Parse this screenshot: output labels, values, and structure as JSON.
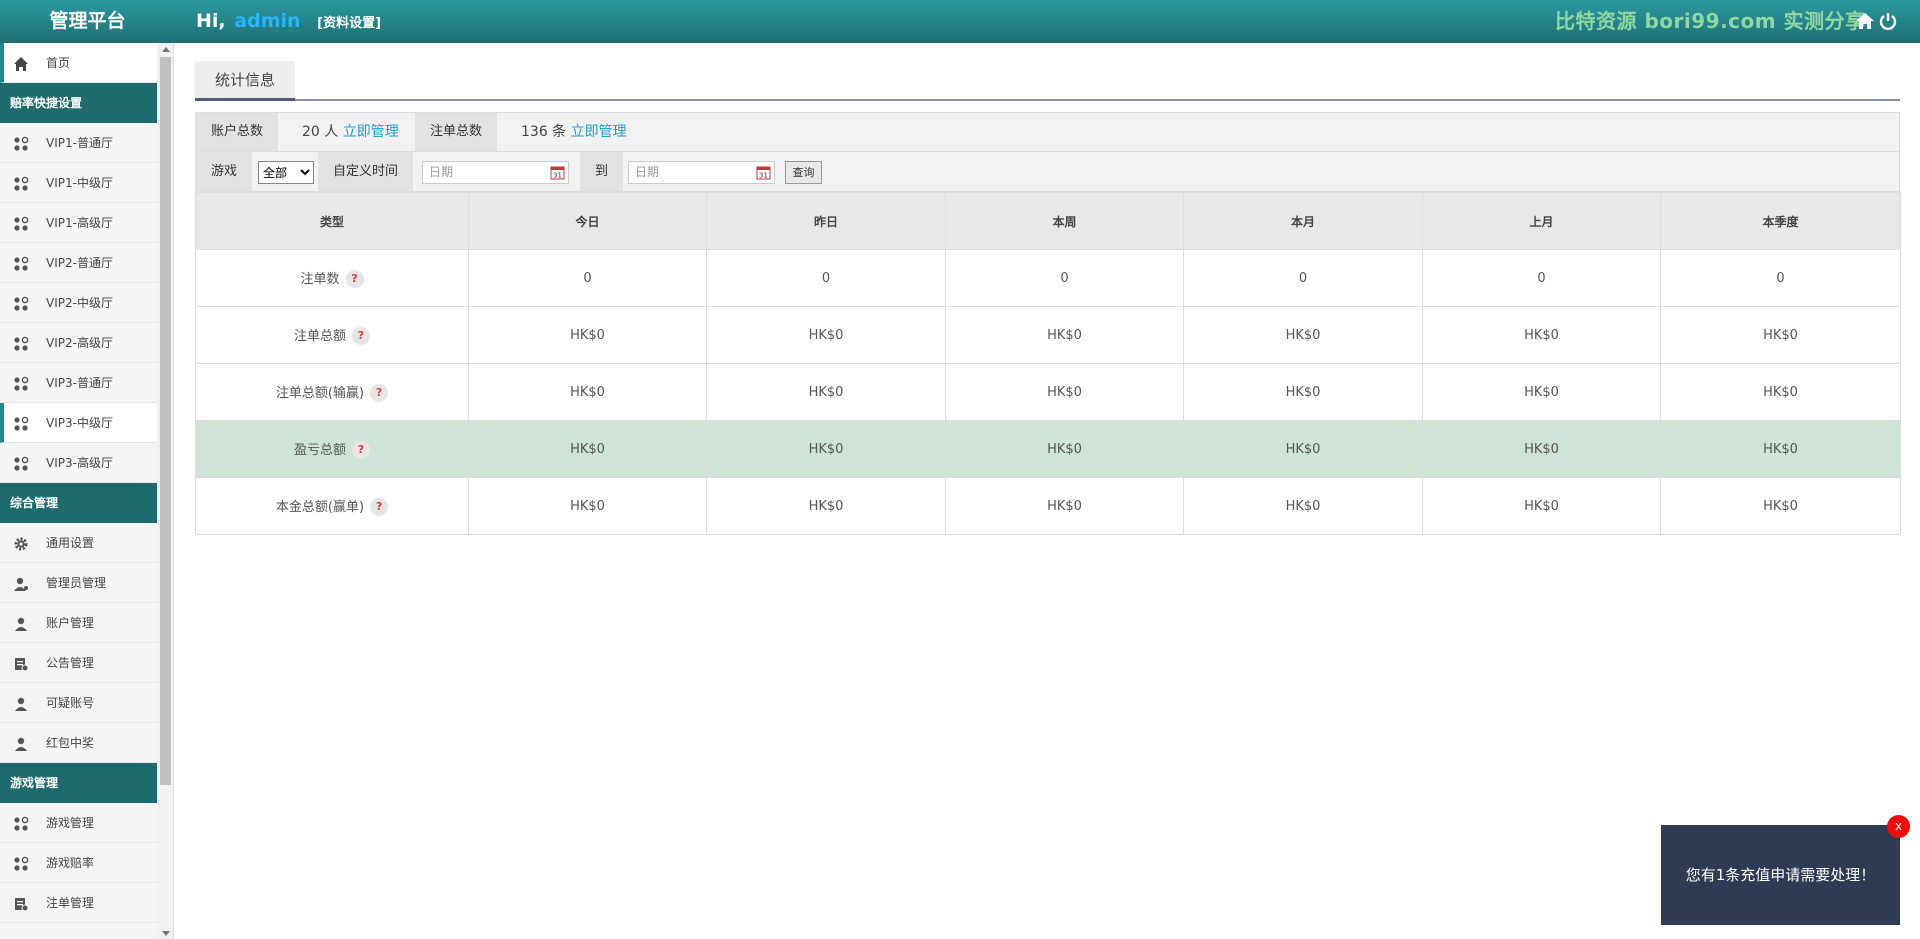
{
  "header": {
    "brand": "管理平台",
    "greeting": "Hi,",
    "username": "admin",
    "profile_link": "[资料设置]",
    "watermark": "比特资源 bori99.com 实测分享"
  },
  "sidebar": {
    "home": "首页",
    "groups": [
      {
        "title": "赔率快捷设置",
        "items": [
          "VIP1-普通厅",
          "VIP1-中级厅",
          "VIP1-高级厅",
          "VIP2-普通厅",
          "VIP2-中级厅",
          "VIP2-高级厅",
          "VIP3-普通厅",
          "VIP3-中级厅",
          "VIP3-高级厅"
        ]
      },
      {
        "title": "综合管理",
        "items": [
          "通用设置",
          "管理员管理",
          "账户管理",
          "公告管理",
          "可疑账号",
          "红包中奖"
        ]
      },
      {
        "title": "游戏管理",
        "items": [
          "游戏管理",
          "游戏赔率",
          "注单管理"
        ]
      }
    ],
    "active_item": "VIP3-中级厅"
  },
  "main": {
    "tab": "统计信息",
    "summary": {
      "accounts_label": "账户总数",
      "accounts_value": "20 人",
      "accounts_link": "立即管理",
      "orders_label": "注单总数",
      "orders_value": "136 条",
      "orders_link": "立即管理"
    },
    "filter": {
      "game_label": "游戏",
      "game_selected": "全部",
      "custom_time_label": "自定义时间",
      "date_placeholder": "日期",
      "to_label": "到",
      "query_button": "查询"
    },
    "table": {
      "headers": [
        "类型",
        "今日",
        "昨日",
        "本周",
        "本月",
        "上月",
        "本季度"
      ],
      "rows": [
        {
          "label": "注单数",
          "values": [
            "0",
            "0",
            "0",
            "0",
            "0",
            "0"
          ]
        },
        {
          "label": "注单总额",
          "values": [
            "HK$0",
            "HK$0",
            "HK$0",
            "HK$0",
            "HK$0",
            "HK$0"
          ]
        },
        {
          "label": "注单总额(输赢)",
          "values": [
            "HK$0",
            "HK$0",
            "HK$0",
            "HK$0",
            "HK$0",
            "HK$0"
          ]
        },
        {
          "label": "盈亏总额",
          "values": [
            "HK$0",
            "HK$0",
            "HK$0",
            "HK$0",
            "HK$0",
            "HK$0"
          ]
        },
        {
          "label": "本金总额(赢单)",
          "values": [
            "HK$0",
            "HK$0",
            "HK$0",
            "HK$0",
            "HK$0",
            "HK$0"
          ]
        }
      ],
      "help_icon_text": "?"
    }
  },
  "notice": {
    "text": "您有1条充值申请需要处理！",
    "close": "x"
  },
  "colors": {
    "header_bg": "#1f6e73",
    "section_bg": "#1e6b6e",
    "link": "#1a9fc9",
    "highlight_row": "#cfe3d6",
    "notice_bg": "#2f3a55",
    "close_bg": "#f30b0b"
  }
}
